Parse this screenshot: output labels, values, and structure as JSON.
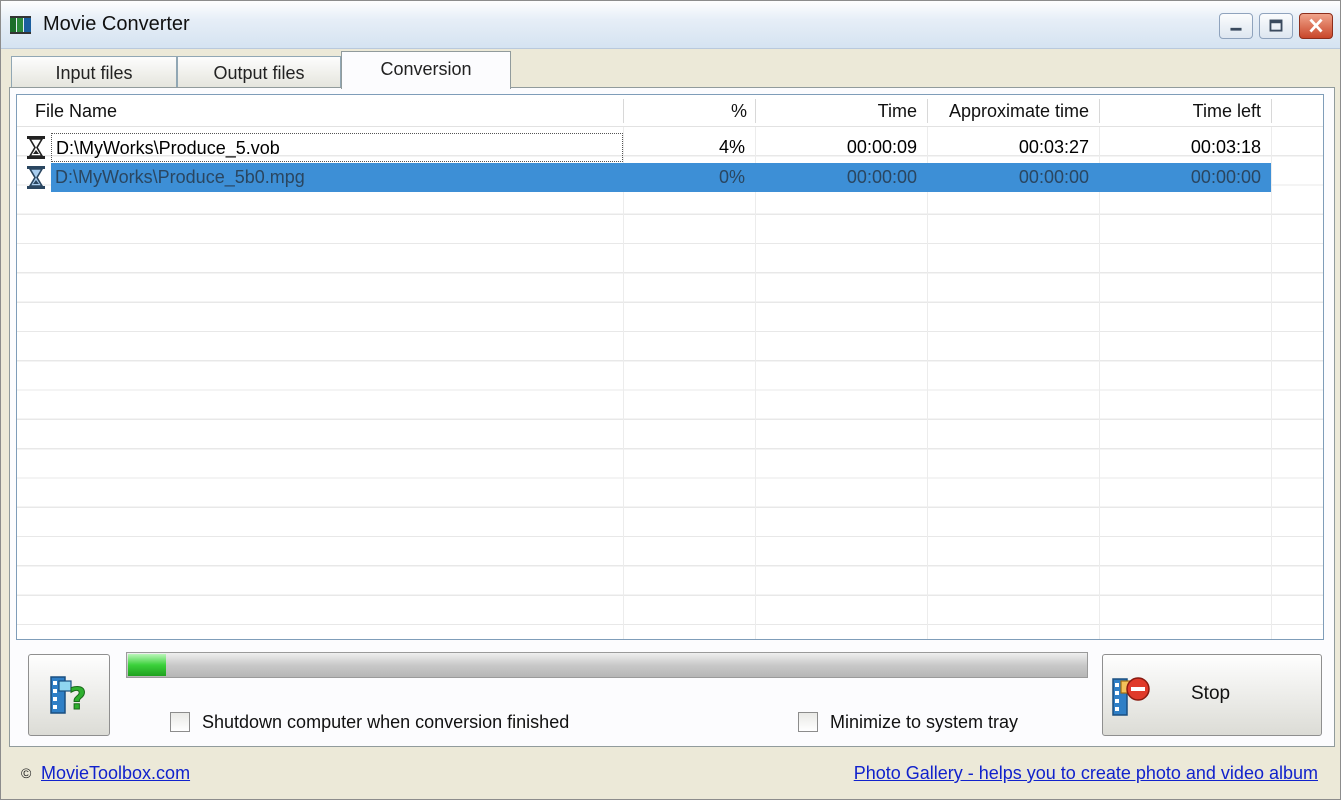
{
  "window": {
    "title": "Movie Converter",
    "controls": [
      "minimize",
      "maximize",
      "close"
    ]
  },
  "tabs": [
    {
      "label": "Input files",
      "active": false
    },
    {
      "label": "Output files",
      "active": false
    },
    {
      "label": "Conversion",
      "active": true
    }
  ],
  "table": {
    "columns": [
      "File Name",
      "%",
      "Time",
      "Approximate time",
      "Time left"
    ],
    "rows": [
      {
        "icon": "hourglass-icon",
        "file": "D:\\MyWorks\\Produce_5.vob",
        "percent": "4%",
        "time": "00:00:09",
        "approx": "00:03:27",
        "left": "00:03:18",
        "selected": false
      },
      {
        "icon": "hourglass-icon",
        "file": "D:\\MyWorks\\Produce_5b0.mpg",
        "percent": "0%",
        "time": "00:00:00",
        "approx": "00:00:00",
        "left": "00:00:00",
        "selected": true
      }
    ]
  },
  "progress": {
    "value": 0.04,
    "color": "#2fc42f"
  },
  "options": {
    "shutdown_label": "Shutdown computer when conversion finished",
    "shutdown_checked": false,
    "tray_label": "Minimize to system tray",
    "tray_checked": false
  },
  "buttons": {
    "help_icon": "help-film-icon",
    "stop_label": "Stop",
    "stop_icon": "stop-film-icon"
  },
  "footer": {
    "copyright_symbol": "©",
    "left_link": "MovieToolbox.com",
    "right_link": "Photo Gallery - helps you to create photo and video album"
  },
  "colors": {
    "selection": "#3d8fd6",
    "link": "#1122cc"
  }
}
